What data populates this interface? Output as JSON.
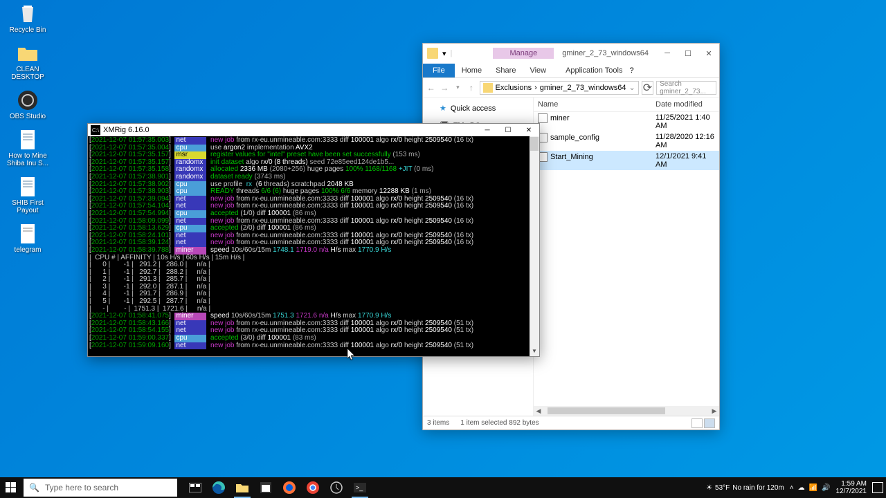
{
  "desktop": {
    "icons": [
      {
        "label": "Recycle Bin"
      },
      {
        "label": "CLEAN DESKTOP"
      },
      {
        "label": "OBS Studio"
      },
      {
        "label": "How to Mine Shiba Inu S..."
      },
      {
        "label": "SHIB First Payout"
      },
      {
        "label": "telegram"
      }
    ]
  },
  "explorer": {
    "manage": "Manage",
    "app_tools": "Application Tools",
    "title": "gminer_2_73_windows64",
    "ribbon": {
      "file": "File",
      "tabs": [
        "Home",
        "Share",
        "View"
      ]
    },
    "address": {
      "segments": [
        "Exclusions",
        "gminer_2_73_windows64"
      ],
      "search_placeholder": "Search gminer_2_73..."
    },
    "nav": {
      "quick_access": "Quick access",
      "this_pc": "This PC"
    },
    "columns": {
      "name": "Name",
      "date": "Date modified"
    },
    "rows": [
      {
        "name": "miner",
        "date": "11/25/2021 1:40 AM",
        "sel": false
      },
      {
        "name": "sample_config",
        "date": "11/28/2020 12:16 AM",
        "sel": false
      },
      {
        "name": "Start_Mining",
        "date": "12/1/2021 9:41 AM",
        "sel": true
      }
    ],
    "status": {
      "items": "3 items",
      "selected": "1 item selected  892 bytes"
    }
  },
  "console": {
    "title": "XMRig 6.16.0",
    "lines": [
      {
        "ts": "2021-12-07 01:57:35.003",
        "tag": "net",
        "html": "<span class='kw-new'>new job</span> from rx-eu.unmineable.com:3333 diff <span class='kw-white'>100001</span> algo <span class='kw-white'>rx/0</span> height <span class='kw-white'>2509540</span> (16 tx)"
      },
      {
        "ts": "2021-12-07 01:57:35.004",
        "tag": "cpu",
        "html": "use <span class='kw-white'>argon2</span> implementation <span class='kw-white'>AVX2</span>"
      },
      {
        "ts": "2021-12-07 01:57:35.157",
        "tag": "msr",
        "html": "<span class='kw-ok'>register values for \"intel\" preset have been set successfully</span> <span class='kw-info'>(153 ms)</span>"
      },
      {
        "ts": "2021-12-07 01:57:35.157",
        "tag": "randomx",
        "html": "<span class='kw-ok'>init dataset</span> algo <span class='kw-white'>rx/0 (8 threads)</span> <span class='kw-info'>seed 72e85eed124de1b5...</span>"
      },
      {
        "ts": "2021-12-07 01:57:35.158",
        "tag": "randomx",
        "html": "<span class='kw-ok'>allocated</span> <span class='kw-white'>2336 MB</span> <span class='kw-info'>(2080+256)</span> huge pages <span class='kw-ok'>100% 1168/1168</span> <span class='kw-cyan'>+JIT</span> <span class='kw-info'>(0 ms)</span>"
      },
      {
        "ts": "2021-12-07 01:57:38.901",
        "tag": "randomx",
        "html": "<span class='kw-ok'>dataset ready</span> <span class='kw-info'>(3743 ms)</span>"
      },
      {
        "ts": "2021-12-07 01:57:38.902",
        "tag": "cpu",
        "html": "use profile <span class='kw-cyan'> rx </span> (<span class='kw-white'>6</span> threads) scratchpad <span class='kw-white'>2048 KB</span>"
      },
      {
        "ts": "2021-12-07 01:57:38.903",
        "tag": "cpu",
        "html": "<span class='kw-ok'>READY</span> threads <span class='kw-ok'>6/6 (6)</span> huge pages <span class='kw-ok'>100% 6/6</span> memory <span class='kw-white'>12288 KB</span> <span class='kw-info'>(1 ms)</span>"
      },
      {
        "ts": "2021-12-07 01:57:39.094",
        "tag": "net",
        "html": "<span class='kw-new'>new job</span> from rx-eu.unmineable.com:3333 diff <span class='kw-white'>100001</span> algo <span class='kw-white'>rx/0</span> height <span class='kw-white'>2509540</span> (16 tx)"
      },
      {
        "ts": "2021-12-07 01:57:54.104",
        "tag": "net",
        "html": "<span class='kw-new'>new job</span> from rx-eu.unmineable.com:3333 diff <span class='kw-white'>100001</span> algo <span class='kw-white'>rx/0</span> height <span class='kw-white'>2509540</span> (16 tx)"
      },
      {
        "ts": "2021-12-07 01:57:54.994",
        "tag": "cpu",
        "html": "<span class='kw-ok'>accepted</span> (1/0) diff <span class='kw-white'>100001</span> <span class='kw-info'>(86 ms)</span>"
      },
      {
        "ts": "2021-12-07 01:58:09.099",
        "tag": "net",
        "html": "<span class='kw-new'>new job</span> from rx-eu.unmineable.com:3333 diff <span class='kw-white'>100001</span> algo <span class='kw-white'>rx/0</span> height <span class='kw-white'>2509540</span> (16 tx)"
      },
      {
        "ts": "2021-12-07 01:58:13.629",
        "tag": "cpu",
        "html": "<span class='kw-ok'>accepted</span> (2/0) diff <span class='kw-white'>100001</span> <span class='kw-info'>(86 ms)</span>"
      },
      {
        "ts": "2021-12-07 01:58:24.101",
        "tag": "net",
        "html": "<span class='kw-new'>new job</span> from rx-eu.unmineable.com:3333 diff <span class='kw-white'>100001</span> algo <span class='kw-white'>rx/0</span> height <span class='kw-white'>2509540</span> (16 tx)"
      },
      {
        "ts": "2021-12-07 01:58:39.124",
        "tag": "net",
        "html": "<span class='kw-new'>new job</span> from rx-eu.unmineable.com:3333 diff <span class='kw-white'>100001</span> algo <span class='kw-white'>rx/0</span> height <span class='kw-white'>2509540</span> (16 tx)"
      },
      {
        "ts": "2021-12-07 01:58:39.788",
        "tag": "miner",
        "html": "<span class='kw-white'>speed</span> 10s/60s/15m <span class='kw-cyan'>1748.1</span> <span class='kw-purple'>1719.0 n/a</span> <span class='kw-white'>H/s</span> max <span class='kw-cyan'>1770.9 H/s</span>"
      }
    ],
    "table": {
      "hdr": "|  CPU # | AFFINITY | 10s H/s | 60s H/s | 15m H/s |",
      "rows": [
        "|      0 |       -1 |   291.2 |   286.0 |     n/a |",
        "|      1 |       -1 |   292.7 |   288.2 |     n/a |",
        "|      2 |       -1 |   291.3 |   285.7 |     n/a |",
        "|      3 |       -1 |   292.0 |   287.1 |     n/a |",
        "|      4 |       -1 |   291.7 |   286.9 |     n/a |",
        "|      5 |       -1 |   292.5 |   287.7 |     n/a |",
        "|      - |        - |  1751.3 |  1721.6 |     n/a |"
      ]
    },
    "lines2": [
      {
        "ts": "2021-12-07 01:58:41.075",
        "tag": "miner",
        "html": "<span class='kw-white'>speed</span> 10s/60s/15m <span class='kw-cyan'>1751.3</span> <span class='kw-purple'>1721.6 n/a</span> <span class='kw-white'>H/s</span> max <span class='kw-cyan'>1770.9 H/s</span>"
      },
      {
        "ts": "2021-12-07 01:58:43.166",
        "tag": "net",
        "html": "<span class='kw-new'>new job</span> from rx-eu.unmineable.com:3333 diff <span class='kw-white'>100001</span> algo <span class='kw-white'>rx/0</span> height <span class='kw-white'>2509540</span> (51 tx)"
      },
      {
        "ts": "2021-12-07 01:58:54.155",
        "tag": "net",
        "html": "<span class='kw-new'>new job</span> from rx-eu.unmineable.com:3333 diff <span class='kw-white'>100001</span> algo <span class='kw-white'>rx/0</span> height <span class='kw-white'>2509540</span> (51 tx)"
      },
      {
        "ts": "2021-12-07 01:59:00.337",
        "tag": "cpu",
        "html": "<span class='kw-ok'>accepted</span> (3/0) diff <span class='kw-white'>100001</span> <span class='kw-info'>(83 ms)</span>"
      },
      {
        "ts": "2021-12-07 01:59:09.160",
        "tag": "net",
        "html": "<span class='kw-new'>new job</span> from rx-eu.unmineable.com:3333 diff <span class='kw-white'>100001</span> algo <span class='kw-white'>rx/0</span> height <span class='kw-white'>2509540</span> (51 tx)"
      }
    ]
  },
  "taskbar": {
    "search_placeholder": "Type here to search",
    "weather": {
      "temp": "53°F",
      "text": "No rain for 120m"
    },
    "clock": {
      "time": "1:59 AM",
      "date": "12/7/2021"
    }
  }
}
